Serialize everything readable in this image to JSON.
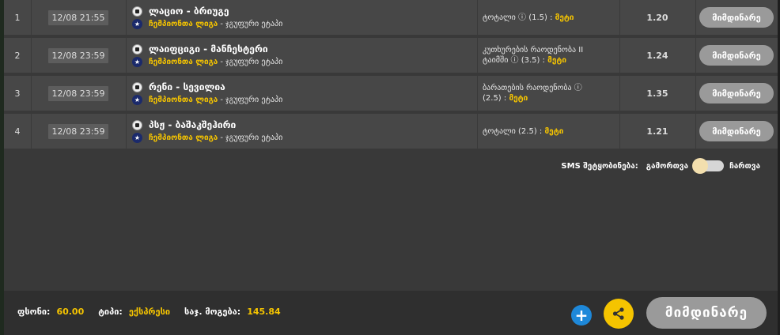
{
  "bets": [
    {
      "num": "1",
      "datetime": "12/08 21:55",
      "match": "ლაციო - ბრიუგე",
      "league": "ჩემპიონთა ლიგა",
      "stage": "ჯგუფური ეტაპი",
      "market_prefix": "ტოტალი ⓘ (1.5) : ",
      "market_suffix": "",
      "selection": "მეტი",
      "odds": "1.20",
      "status": "მიმდინარე"
    },
    {
      "num": "2",
      "datetime": "12/08 23:59",
      "match": "ლაიფციგი - მანჩესტერი",
      "league": "ჩემპიონთა ლიგა",
      "stage": "ჯგუფური ეტაპი",
      "market_prefix": "კუთხურების რაოდენობა II",
      "market_suffix": "ტაიმში ⓘ (3.5) : ",
      "selection": "მეტი",
      "odds": "1.24",
      "status": "მიმდინარე"
    },
    {
      "num": "3",
      "datetime": "12/08 23:59",
      "match": "რენი - სევილია",
      "league": "ჩემპიონთა ლიგა",
      "stage": "ჯგუფური ეტაპი",
      "market_prefix": "ბარათების რაოდენობა ⓘ",
      "market_suffix": "(2.5) : ",
      "selection": "მეტი",
      "odds": "1.35",
      "status": "მიმდინარე"
    },
    {
      "num": "4",
      "datetime": "12/08 23:59",
      "match": "პსჟ - ბაშაკშეჰირი",
      "league": "ჩემპიონთა ლიგა",
      "stage": "ჯგუფური ეტაპი",
      "market_prefix": "ტოტალი (2.5) : ",
      "market_suffix": "",
      "selection": "მეტი",
      "odds": "1.21",
      "status": "მიმდინარე"
    }
  ],
  "sms": {
    "label": "SMS შეტყობინება:",
    "off_label": "გამორთვა",
    "on_label": "ჩართვა"
  },
  "footer": {
    "stake_label": "ფსონი:",
    "stake_value": "60.00",
    "type_label": "ტიპი:",
    "type_value": "ექსპრესი",
    "win_label": "საჯ. მოგება:",
    "win_value": "145.84",
    "plus_label": "+",
    "status_button": "მიმდინარე"
  },
  "icons": {
    "ball": "soccer-ball-icon",
    "league": "champions-league-icon",
    "share": "share-icon",
    "plus": "plus-icon"
  },
  "colors": {
    "accent_yellow": "#f5c400",
    "plus_blue": "#1e88d9",
    "status_gray": "#9a9a9a"
  }
}
